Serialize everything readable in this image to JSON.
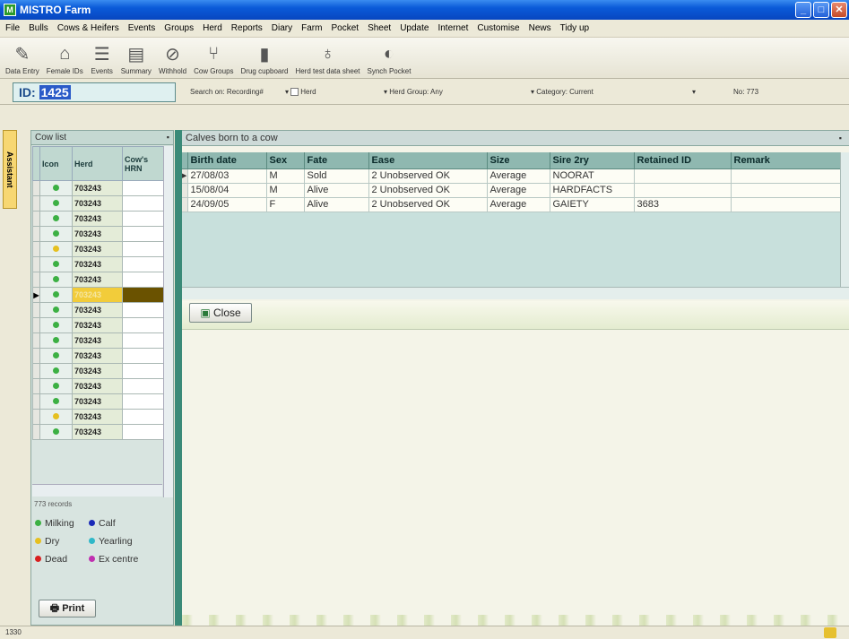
{
  "window": {
    "title": "MISTRO Farm",
    "app_icon": "M"
  },
  "menu": [
    "File",
    "Bulls",
    "Cows & Heifers",
    "Events",
    "Groups",
    "Herd",
    "Reports",
    "Diary",
    "Farm",
    "Pocket",
    "Sheet",
    "Update",
    "Internet",
    "Customise",
    "News",
    "Tidy up"
  ],
  "toolbar": [
    {
      "label": "Data Entry",
      "icon": "pencil-icon"
    },
    {
      "label": "Female IDs",
      "icon": "barn-icon"
    },
    {
      "label": "Events",
      "icon": "list-icon"
    },
    {
      "label": "Summary",
      "icon": "document-icon"
    },
    {
      "label": "Withhold",
      "icon": "no-entry-icon"
    },
    {
      "label": "Cow Groups",
      "icon": "cow-group-icon"
    },
    {
      "label": "Drug cupboard",
      "icon": "bottle-icon"
    },
    {
      "label": "Herd test data sheet",
      "icon": "flask-icon"
    },
    {
      "label": "Synch Pocket",
      "icon": "sync-icon"
    }
  ],
  "idbar": {
    "id_label": "ID:",
    "id_value": "1425",
    "search_on": "Search on: Recording#",
    "herd": "Herd",
    "herd_group": "Herd Group: Any",
    "category": "Category: Current",
    "count": "No: 773"
  },
  "assistant_tab": "Assistant",
  "cow_list": {
    "title": "Cow list",
    "columns": [
      "Icon",
      "Herd",
      "Cow's HRN"
    ],
    "rows": [
      {
        "status": "milking",
        "herd": "703243"
      },
      {
        "status": "milking",
        "herd": "703243"
      },
      {
        "status": "milking",
        "herd": "703243"
      },
      {
        "status": "milking",
        "herd": "703243"
      },
      {
        "status": "dry",
        "herd": "703243"
      },
      {
        "status": "milking",
        "herd": "703243"
      },
      {
        "status": "milking",
        "herd": "703243"
      },
      {
        "status": "milking",
        "herd": "703243",
        "selected": true
      },
      {
        "status": "milking",
        "herd": "703243"
      },
      {
        "status": "milking",
        "herd": "703243"
      },
      {
        "status": "milking",
        "herd": "703243"
      },
      {
        "status": "milking",
        "herd": "703243"
      },
      {
        "status": "milking",
        "herd": "703243"
      },
      {
        "status": "milking",
        "herd": "703243"
      },
      {
        "status": "milking",
        "herd": "703243"
      },
      {
        "status": "dry",
        "herd": "703243"
      },
      {
        "status": "milking",
        "herd": "703243"
      }
    ],
    "records": "773 records",
    "print_label": "Print"
  },
  "legend": [
    {
      "label": "Milking",
      "color": "#3cb043"
    },
    {
      "label": "Calf",
      "color": "#1a2ab8"
    },
    {
      "label": "Dry",
      "color": "#e6c020"
    },
    {
      "label": "Yearling",
      "color": "#30b8c8"
    },
    {
      "label": "Dead",
      "color": "#d82020"
    },
    {
      "label": "Ex centre",
      "color": "#c030b0"
    }
  ],
  "calves": {
    "title": "Calves born to a cow",
    "columns": [
      "Birth date",
      "Sex",
      "Fate",
      "Ease",
      "Size",
      "Sire 2ry",
      "Retained ID",
      "Remark"
    ],
    "rows": [
      [
        "27/08/03",
        "M",
        "Sold",
        "2 Unobserved OK",
        "Average",
        "NOORAT",
        "",
        ""
      ],
      [
        "15/08/04",
        "M",
        "Alive",
        "2 Unobserved OK",
        "Average",
        "HARDFACTS",
        "",
        ""
      ],
      [
        "24/09/05",
        "F",
        "Alive",
        "2 Unobserved OK",
        "Average",
        "GAIETY",
        "3683",
        ""
      ]
    ],
    "close_label": "Close"
  },
  "status": {
    "left": "1330"
  },
  "colors": {
    "milking": "#3cb043",
    "dry": "#e6c020",
    "accent": "#3a8a78"
  }
}
